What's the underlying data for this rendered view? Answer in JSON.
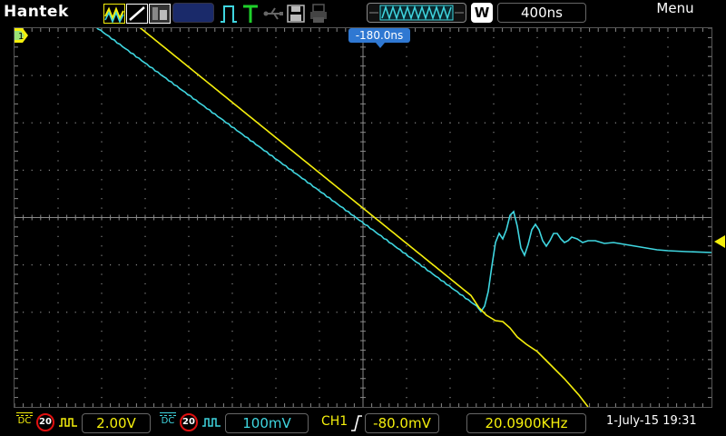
{
  "brand": "Hantek",
  "top_bar": {
    "timebase": "400ns",
    "acquire_mode": "W",
    "menu_label": "Menu"
  },
  "screen": {
    "horizontal_position": "-180.0ns",
    "ch1_marker": "1"
  },
  "channel1": {
    "coupling": "DC",
    "bandwidth_limit": "20",
    "volts_per_div": "2.00V",
    "color": "#f5ef0c"
  },
  "channel2": {
    "coupling": "DC",
    "bandwidth_limit": "20",
    "volts_per_div": "100mV",
    "color": "#3fd6e0"
  },
  "trigger": {
    "source": "CH1",
    "edge": "rising",
    "level": "-80.0mV"
  },
  "frequency": "20.0900KHz",
  "datetime": "1-July-15 19:31",
  "colors": {
    "grid": "#888888",
    "accent_blue": "#2f78d2",
    "bw_limit_ring": "#e01010"
  }
}
